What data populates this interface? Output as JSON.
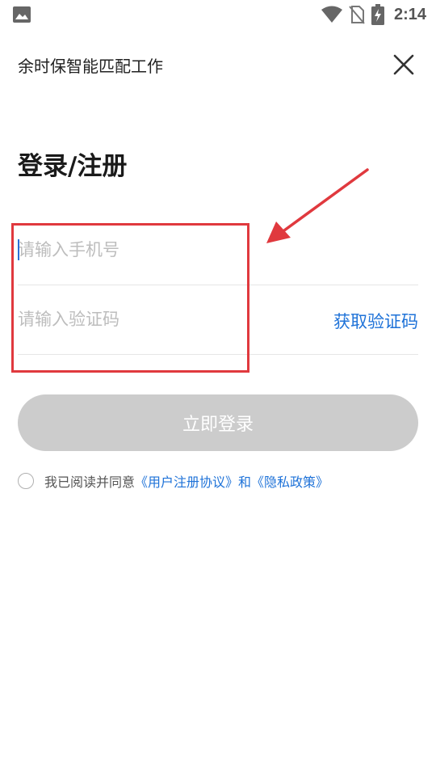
{
  "status_bar": {
    "time": "2:14",
    "icons": [
      "gallery-icon",
      "wifi-icon",
      "no-sim-icon",
      "battery-charging-icon"
    ]
  },
  "header": {
    "title": "余时保智能匹配工作",
    "close_icon": "close-icon"
  },
  "page": {
    "heading": "登录/注册"
  },
  "form": {
    "phone_placeholder": "请输入手机号",
    "code_placeholder": "请输入验证码",
    "get_code_label": "获取验证码",
    "submit_label": "立即登录"
  },
  "agreement": {
    "prefix": "我已阅读并同意",
    "user_agreement": "《用户注册协议》",
    "conjunction": "和",
    "privacy_policy": "《隐私政策》"
  },
  "colors": {
    "accent": "#1e72d8",
    "button_disabled": "#cccccc",
    "annotation": "#e0393e"
  }
}
